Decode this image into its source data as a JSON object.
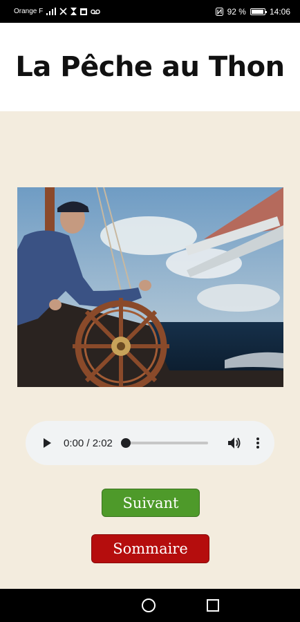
{
  "status_bar": {
    "carrier": "Orange F",
    "battery": "92 %",
    "time": "14:06"
  },
  "header": {
    "title": "La Pêche au Thon"
  },
  "audio_player": {
    "time": "0:00 / 2:02",
    "progress": 0
  },
  "buttons": {
    "next_label": "Suivant",
    "menu_label": "Sommaire"
  },
  "colors": {
    "background": "#f3ecde",
    "next_button": "#4e9a2a",
    "menu_button": "#b50d0d"
  },
  "photo": {
    "icon": "sailor-at-ship-wheel-photo"
  }
}
